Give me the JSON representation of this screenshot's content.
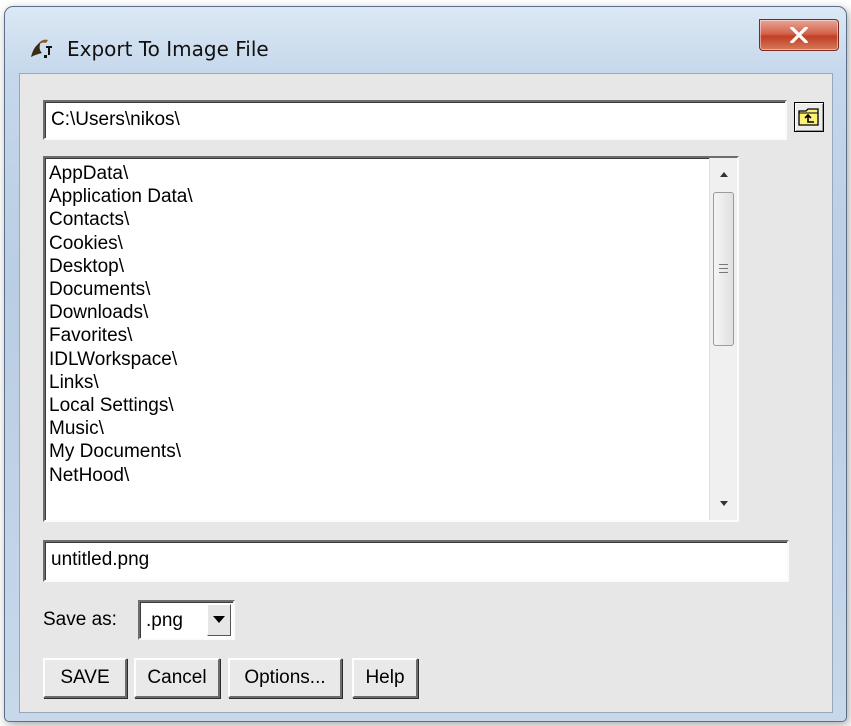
{
  "window": {
    "title": "Export To Image File",
    "close_icon": "close-x-icon",
    "app_icon": "idl-app-icon"
  },
  "path": {
    "value": "C:\\Users\\nikos\\",
    "up_folder_icon": "folder-up-icon"
  },
  "file_list": {
    "items": [
      "AppData\\",
      "Application Data\\",
      "Contacts\\",
      "Cookies\\",
      "Desktop\\",
      "Documents\\",
      "Downloads\\",
      "Favorites\\",
      "IDLWorkspace\\",
      "Links\\",
      "Local Settings\\",
      "Music\\",
      "My Documents\\",
      "NetHood\\"
    ],
    "scroll_up_icon": "arrow-up-icon",
    "scroll_down_icon": "arrow-down-icon"
  },
  "filename": {
    "value": "untitled.png"
  },
  "save_as": {
    "label": "Save as:",
    "selected": ".png"
  },
  "buttons": {
    "save": "SAVE",
    "cancel": "Cancel",
    "options": "Options...",
    "help": "Help"
  },
  "colors": {
    "frame": "#c4d7eb",
    "client_bg": "#e7e7e7",
    "close_red": "#c13f22"
  }
}
